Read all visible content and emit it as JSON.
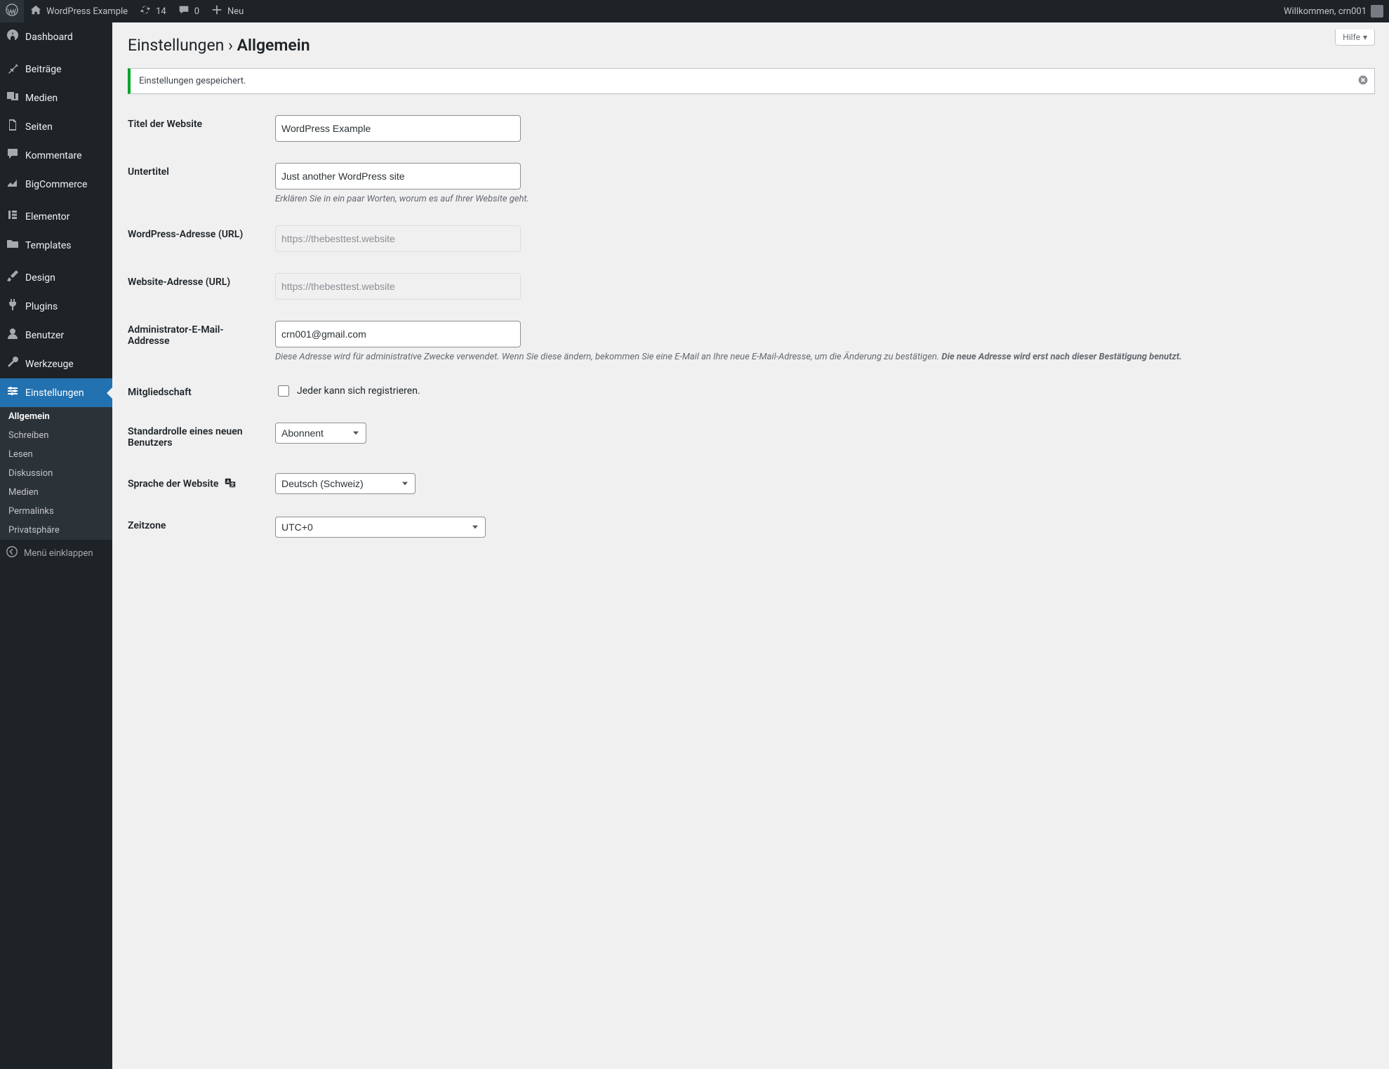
{
  "adminbar": {
    "site_name": "WordPress Example",
    "updates": "14",
    "comments": "0",
    "new_label": "Neu",
    "howdy": "Willkommen, crn001"
  },
  "sidebar": {
    "items": [
      {
        "label": "Dashboard",
        "icon": "dashboard",
        "kind": "top"
      },
      {
        "kind": "sep"
      },
      {
        "label": "Beiträge",
        "icon": "pin",
        "kind": "top"
      },
      {
        "label": "Medien",
        "icon": "media",
        "kind": "top"
      },
      {
        "label": "Seiten",
        "icon": "page",
        "kind": "top"
      },
      {
        "label": "Kommentare",
        "icon": "comment",
        "kind": "top"
      },
      {
        "label": "BigCommerce",
        "icon": "chart",
        "kind": "top"
      },
      {
        "kind": "sep"
      },
      {
        "label": "Elementor",
        "icon": "elementor",
        "kind": "top"
      },
      {
        "label": "Templates",
        "icon": "folder",
        "kind": "top"
      },
      {
        "kind": "sep"
      },
      {
        "label": "Design",
        "icon": "brush",
        "kind": "top"
      },
      {
        "label": "Plugins",
        "icon": "plug",
        "kind": "top"
      },
      {
        "label": "Benutzer",
        "icon": "user",
        "kind": "top"
      },
      {
        "label": "Werkzeuge",
        "icon": "wrench",
        "kind": "top"
      },
      {
        "label": "Einstellungen",
        "icon": "settings",
        "kind": "top",
        "current": true
      }
    ],
    "submenu": [
      {
        "label": "Allgemein",
        "active": true
      },
      {
        "label": "Schreiben"
      },
      {
        "label": "Lesen"
      },
      {
        "label": "Diskussion"
      },
      {
        "label": "Medien"
      },
      {
        "label": "Permalinks"
      },
      {
        "label": "Privatsphäre"
      }
    ],
    "collapse": "Menü einklappen"
  },
  "page": {
    "help": "Hilfe",
    "title_1": "Einstellungen",
    "title_sep": " › ",
    "title_2": "Allgemein",
    "notice": "Einstellungen gespeichert."
  },
  "fields": {
    "site_title": {
      "label": "Titel der Website",
      "value": "WordPress Example"
    },
    "tagline": {
      "label": "Untertitel",
      "value": "Just another WordPress site",
      "desc": "Erklären Sie in ein paar Worten, worum es auf Ihrer Website geht."
    },
    "wp_url": {
      "label": "WordPress-Adresse (URL)",
      "value": "https://thebesttest.website"
    },
    "site_url": {
      "label": "Website-Adresse (URL)",
      "value": "https://thebesttest.website"
    },
    "admin_email": {
      "label": "Administrator-E-Mail-Addresse",
      "value": "crn001@gmail.com",
      "desc_1": "Diese Adresse wird für administrative Zwecke verwendet. Wenn Sie diese ändern, bekommen Sie eine E-Mail an Ihre neue E-Mail-Adresse, um die Änderung zu bestätigen. ",
      "desc_2": "Die neue Adresse wird erst nach dieser Bestätigung benutzt."
    },
    "membership": {
      "label": "Mitgliedschaft",
      "checkbox": "Jeder kann sich registrieren."
    },
    "default_role": {
      "label": "Standardrolle eines neuen Benutzers",
      "value": "Abonnent"
    },
    "language": {
      "label": "Sprache der Website",
      "value": "Deutsch (Schweiz)"
    },
    "timezone": {
      "label": "Zeitzone",
      "value": "UTC+0"
    }
  }
}
